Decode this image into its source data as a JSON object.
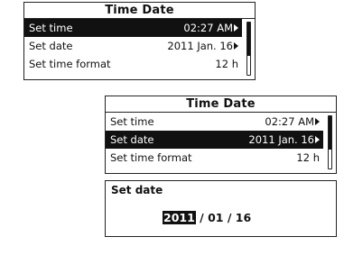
{
  "screens": [
    {
      "title": "Time Date",
      "items": [
        {
          "label": "Set time",
          "value": "02:27 AM",
          "selected": true,
          "has_arrow": true
        },
        {
          "label": "Set date",
          "value": "2011 Jan. 16",
          "selected": false,
          "has_arrow": true
        },
        {
          "label": "Set time format",
          "value": "12 h",
          "selected": false,
          "has_arrow": false
        }
      ]
    },
    {
      "title": "Time Date",
      "items": [
        {
          "label": "Set time",
          "value": "02:27 AM",
          "selected": false,
          "has_arrow": true
        },
        {
          "label": "Set date",
          "value": "2011 Jan. 16",
          "selected": true,
          "has_arrow": true
        },
        {
          "label": "Set time format",
          "value": "12 h",
          "selected": false,
          "has_arrow": false
        }
      ]
    }
  ],
  "date_editor": {
    "title": "Set date",
    "year": "2011",
    "separator": " / ",
    "month": "01",
    "day": "16",
    "active_field": "year"
  },
  "icons": {
    "row_arrow": "chevron-right-icon"
  },
  "colors": {
    "selected_bg": "#111111",
    "selected_fg": "#ffffff",
    "border": "#222222"
  }
}
